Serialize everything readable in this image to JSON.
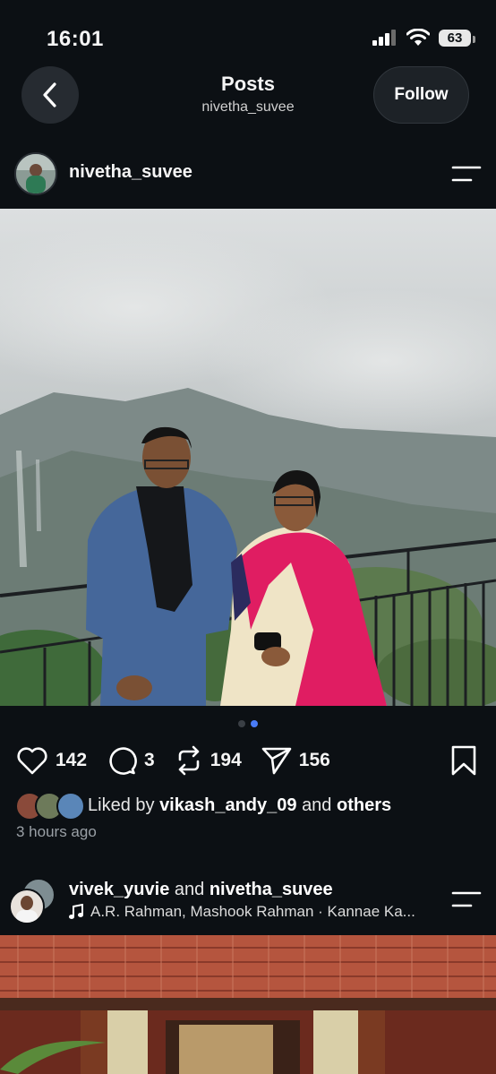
{
  "status_bar": {
    "time": "16:01",
    "battery": "63"
  },
  "header": {
    "title": "Posts",
    "subtitle": "nivetha_suvee",
    "follow_label": "Follow"
  },
  "post": {
    "username": "nivetha_suvee",
    "carousel_active_index": 2,
    "carousel_total": 2,
    "likes": "142",
    "comments": "3",
    "reposts": "194",
    "shares": "156",
    "liked_by_prefix": "Liked by",
    "liked_by_user": "vikash_andy_09",
    "liked_by_and": "and",
    "liked_by_others": "others",
    "time_ago": "3 hours ago"
  },
  "next_post": {
    "user1": "vivek_yuvie",
    "and": "and",
    "user2": "nivetha_suvee",
    "music": "A.R. Rahman, Mashook Rahman · Kannae Ka..."
  },
  "colors": {
    "background": "#0c1014",
    "accent": "#4a7cf6"
  }
}
